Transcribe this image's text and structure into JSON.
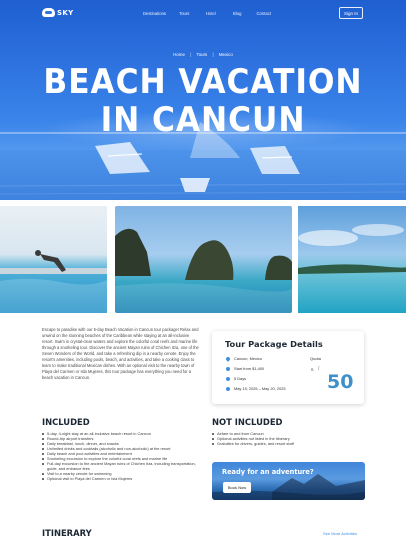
{
  "nav": {
    "logo_text": "SKY",
    "links": [
      "Destinations",
      "Tours",
      "Hotel",
      "Blog",
      "Contact"
    ],
    "sign_in": "Sign In"
  },
  "hero": {
    "breadcrumb": [
      "Home",
      "Tours",
      "Mexico"
    ],
    "title_line1": "BEACH VACATION",
    "title_line2": "IN CANCUN"
  },
  "description": "Escape to paradise with our 5-day Beach Vacation in Cancun tour package! Relax and unwind on the stunning beaches of the Caribbean while staying at an all-inclusive resort. Swim in crystal-clear waters and explore the colorful coral reefs and marine life through a snorkeling tour. Discover the ancient Mayan ruins of Chichen Itza, one of the Seven Wonders of the World, and take a refreshing dip in a nearby cenote. Enjoy the resort's amenities, including pools, beach, and activities, and take a cooking class to learn to make traditional Mexican dishes. With an optional visit to the nearby town of Playa del Carmen or Isla Mujeres, this tour package has everything you need for a beach vacation in Cancun.",
  "package": {
    "title": "Tour Package Details",
    "location": "Cancun, Mexico",
    "price": "Start from $1,400",
    "duration": "5 Days",
    "dates": "May 15, 2025 – May 20, 2025",
    "quota_label": "Quota",
    "quota_taken": "6",
    "quota_separator": "/",
    "quota_total": "50"
  },
  "included": {
    "title": "INCLUDED",
    "items": [
      "5-day, 4-night stay at an all-inclusive beach resort in Cancun",
      "Round-trip airport transfers",
      "Daily breakfast, lunch, dinner, and snacks",
      "Unlimited drinks and cocktails (alcoholic and non-alcoholic) at the resort",
      "Daily beach and pool activities and entertainment",
      "Snorkeling excursion to explore the colorful coral reefs and marine life",
      "Full-day excursion to the ancient Mayan ruins of Chichen Itza, including transportation, guide, and entrance fees",
      "Visit to a nearby cenote for swimming",
      "Optional visit to Playa del Carmen or Isla Mujeres"
    ]
  },
  "not_included": {
    "title": "NOT INCLUDED",
    "items": [
      "Airfare to and from Cancun",
      "Optional activities not listed in the itinerary",
      "Gratuities for drivers, guides, and resort staff"
    ]
  },
  "banner": {
    "title": "Ready for an adventure?",
    "button": "Book Now"
  },
  "itinerary": {
    "title": "ITINERARY",
    "see_more": "See More Activities"
  },
  "colors": {
    "accent": "#3f8fe0",
    "hero_blue": "#2f74e0",
    "heading": "#1b2733"
  }
}
